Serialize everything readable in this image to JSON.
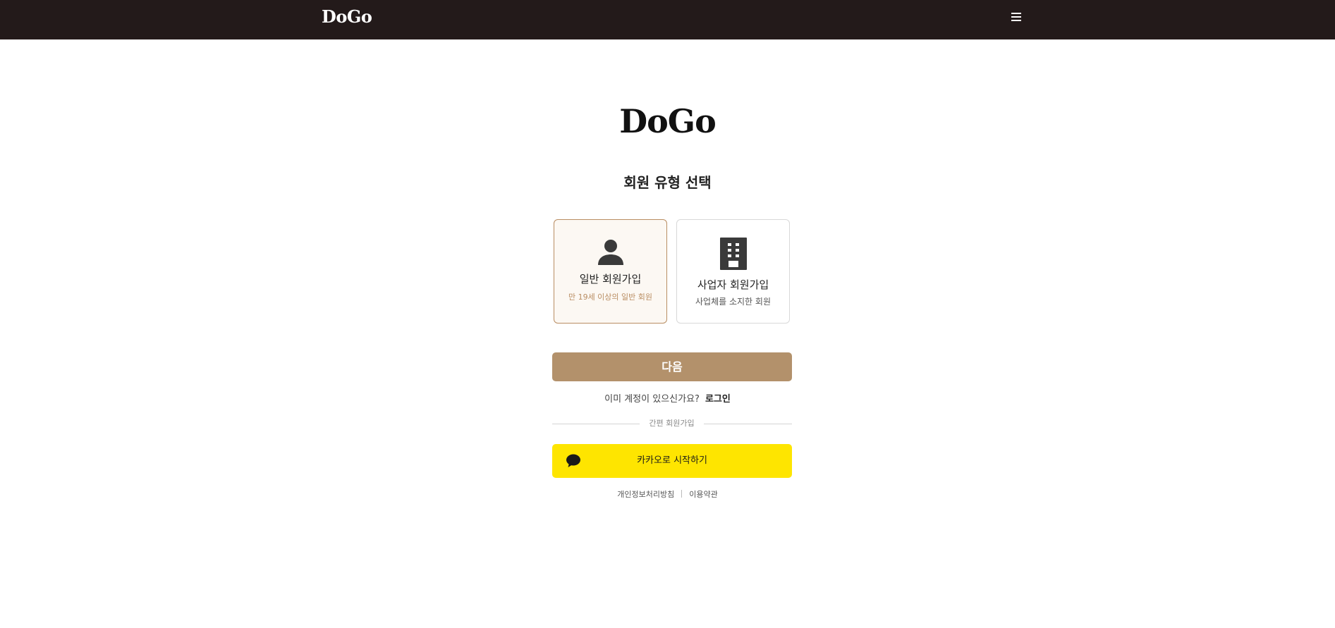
{
  "header": {
    "brand": "DoGo",
    "menu_icon": "hamburger-menu-icon"
  },
  "main": {
    "logo": "DoGo",
    "title": "회원 유형 선택",
    "options": [
      {
        "label": "일반 회원가입",
        "description": "만 19세 이상의 일반 회원",
        "icon": "person-icon",
        "selected": true
      },
      {
        "label": "사업자 회원가입",
        "description": "사업체를 소지한 회원",
        "icon": "building-icon",
        "selected": false
      }
    ],
    "next_button": "다음",
    "login_prompt": "이미 계정이 있으신가요?",
    "login_link": "로그인",
    "divider_text": "간편 회원가입",
    "kakao_button": "카카오로 시작하기",
    "footer": {
      "privacy": "개인정보처리방침",
      "terms": "이용약관"
    }
  },
  "colors": {
    "header_bg": "#231a1a",
    "accent": "#b3916b",
    "selected_border": "#b98d62",
    "kakao_yellow": "#fee500"
  }
}
